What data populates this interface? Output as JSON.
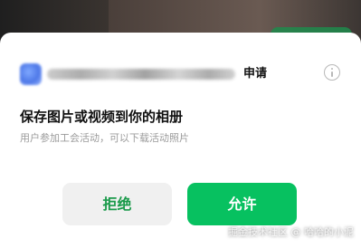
{
  "dialog": {
    "request_label": "申请",
    "info_icon": "info-icon",
    "title": "保存图片或视频到你的相册",
    "description": "用户参加工会活动，可以下载活动照片",
    "buttons": {
      "deny": "拒绝",
      "allow": "允许"
    }
  },
  "watermark": "掘金技术社区 @ 哈哈的小泥",
  "colors": {
    "allow_bg": "#07c160",
    "deny_text": "#1a9a4a",
    "deny_bg": "#f0f0f0",
    "title_text": "#111111",
    "desc_text": "#9b9b9b"
  }
}
